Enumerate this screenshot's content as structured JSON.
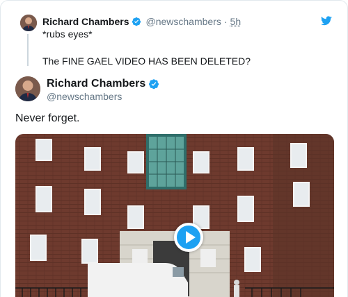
{
  "parent_tweet": {
    "author_name": "Richard Chambers",
    "handle": "@newschambers",
    "separator": "·",
    "time": "5h",
    "line1": "*rubs eyes*",
    "line2": "The FINE GAEL VIDEO HAS BEEN DELETED?"
  },
  "main_tweet": {
    "author_name": "Richard Chambers",
    "handle": "@newschambers",
    "text": "Never forget."
  },
  "colors": {
    "twitter_blue": "#1da1f2",
    "secondary_text": "#657786",
    "border": "#e1e8ed"
  },
  "icons": {
    "brand": "twitter-bird-icon",
    "verified": "verified-badge-icon",
    "media": "play-icon"
  }
}
